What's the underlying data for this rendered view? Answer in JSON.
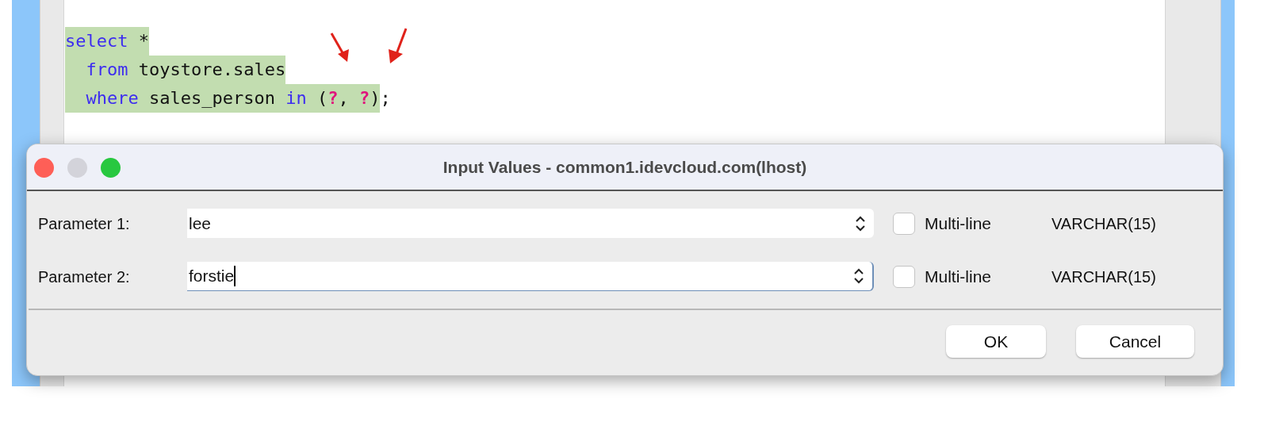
{
  "editor": {
    "lines": [
      {
        "tokens": [
          {
            "kind": "keyword",
            "text": "select",
            "selected": true
          },
          {
            "kind": "plain",
            "text": " *",
            "selected": true
          }
        ]
      },
      {
        "indented": true,
        "tokens": [
          {
            "kind": "keyword",
            "text": "from",
            "selected": true
          },
          {
            "kind": "plain",
            "text": " toystore.sales",
            "selected": true
          }
        ]
      },
      {
        "indented": true,
        "tokens": [
          {
            "kind": "keyword",
            "text": "where",
            "selected": true
          },
          {
            "kind": "plain",
            "text": " sales_person ",
            "selected": true
          },
          {
            "kind": "keyword",
            "text": "in",
            "selected": true
          },
          {
            "kind": "plain",
            "text": " (",
            "selected": true
          },
          {
            "kind": "param",
            "text": "?",
            "selected": true
          },
          {
            "kind": "plain",
            "text": ", ",
            "selected": true
          },
          {
            "kind": "param",
            "text": "?",
            "selected": true
          },
          {
            "kind": "plain",
            "text": ")",
            "selected": true
          },
          {
            "kind": "plain",
            "text": ";",
            "selected": false
          }
        ]
      }
    ]
  },
  "dialog": {
    "title": "Input Values - common1.idevcloud.com(lhost)",
    "window_controls": [
      {
        "kind": "close",
        "disabled": false
      },
      {
        "kind": "minimize",
        "disabled": true
      },
      {
        "kind": "zoom",
        "disabled": false
      }
    ],
    "parameters": [
      {
        "label": "Parameter 1:",
        "value": "lee",
        "focused": false,
        "multiline": {
          "label": "Multi-line",
          "checked": false
        },
        "type": "VARCHAR(15)"
      },
      {
        "label": "Parameter 2:",
        "value": "forstie",
        "focused": true,
        "multiline": {
          "label": "Multi-line",
          "checked": false
        },
        "type": "VARCHAR(15)"
      }
    ],
    "buttons": [
      "OK",
      "Cancel"
    ]
  }
}
